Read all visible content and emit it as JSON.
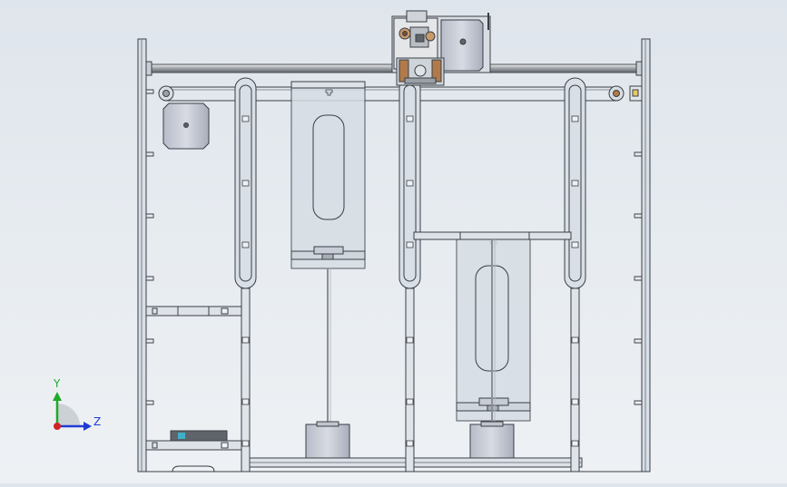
{
  "viewport": {
    "background_top": "#dfe5ec",
    "background_bottom": "#eef1f4"
  },
  "triad": {
    "y_label": "Y",
    "z_label": "Z",
    "y_color": "#1faa2a",
    "z_color": "#1f3bd6",
    "x_color": "#d22222"
  },
  "model": {
    "stroke_color": "#3a3f46",
    "panel_fill": "#d6dde4",
    "motor_fill": "#c7ccd6",
    "carriage_accent": "#b07a4a",
    "blue_accent": "#3fb0c8"
  }
}
